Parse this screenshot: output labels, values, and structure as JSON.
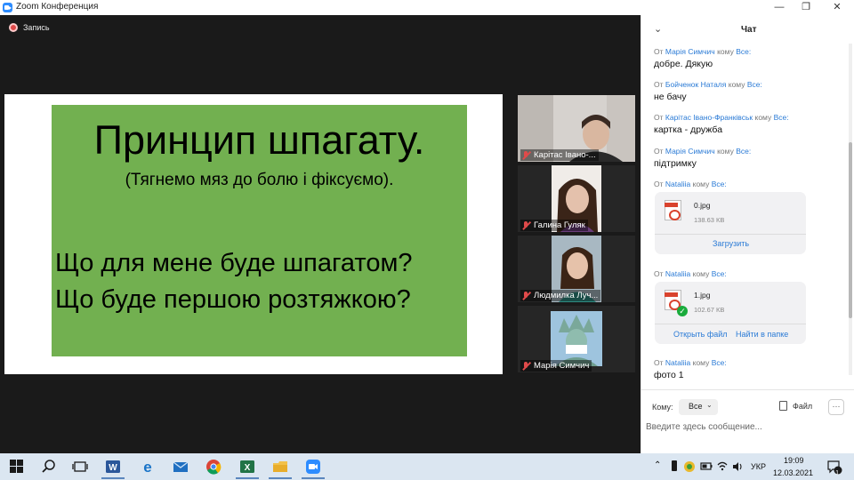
{
  "window": {
    "title": "Zoom Конференция",
    "minimize": "—",
    "restore": "❐",
    "close": "✕"
  },
  "recording": {
    "label": "Запись"
  },
  "slide": {
    "title": "Принцип шпагату.",
    "subtitle": "(Тягнемо мяз до болю і фіксуємо).",
    "line1": "Що для мене буде шпагатом?",
    "line2": "Що буде першою розтяжкою?",
    "background": "#72b050"
  },
  "participants": [
    {
      "name": "Карітас Івано-...",
      "muted": true
    },
    {
      "name": "Галина Гуляк",
      "muted": true
    },
    {
      "name": "Людмилка Луч...",
      "muted": true
    },
    {
      "name": "Марія Симчич",
      "muted": true
    }
  ],
  "chat": {
    "title": "Чат",
    "collapse_icon": "chevron-down-icon",
    "messages": [
      {
        "from_word": "От",
        "sender": "Марія Симчич",
        "to_word": "кому",
        "recipient": "Все:",
        "text": "добре. Дякую"
      },
      {
        "from_word": "От",
        "sender": "Бойченок Наталя",
        "to_word": "кому",
        "recipient": "Все:",
        "text": "не бачу"
      },
      {
        "from_word": "От",
        "sender": "Карітас Івано-Франківськ",
        "to_word": "кому",
        "recipient": "Все:",
        "text": "картка - дружба"
      },
      {
        "from_word": "От",
        "sender": "Марія Симчич",
        "to_word": "кому",
        "recipient": "Все:",
        "text": "підтримку"
      },
      {
        "from_word": "От",
        "sender": "Nataliia",
        "to_word": "кому",
        "recipient": "Все:",
        "file": {
          "name": "0.jpg",
          "size": "138.63 КВ",
          "action": "Загрузить"
        }
      },
      {
        "from_word": "От",
        "sender": "Nataliia",
        "to_word": "кому",
        "recipient": "Все:",
        "file": {
          "name": "1.jpg",
          "size": "102.67 КВ",
          "open": "Открыть файл",
          "folder": "Найти в папке"
        }
      },
      {
        "from_word": "От",
        "sender": "Nataliia",
        "to_word": "кому",
        "recipient": "Все:",
        "text": "фото 1"
      }
    ],
    "to_label": "Кому:",
    "to_value": "Все",
    "file_button": "Файл",
    "more_button": "···",
    "input_placeholder": "Введите здесь сообщение..."
  },
  "taskbar": {
    "language": "УКР",
    "time": "19:09",
    "date": "12.03.2021",
    "notifications": "1"
  },
  "colors": {
    "accent": "#2b7bd6",
    "recording": "#e04a4a",
    "slide_green": "#72b050"
  }
}
